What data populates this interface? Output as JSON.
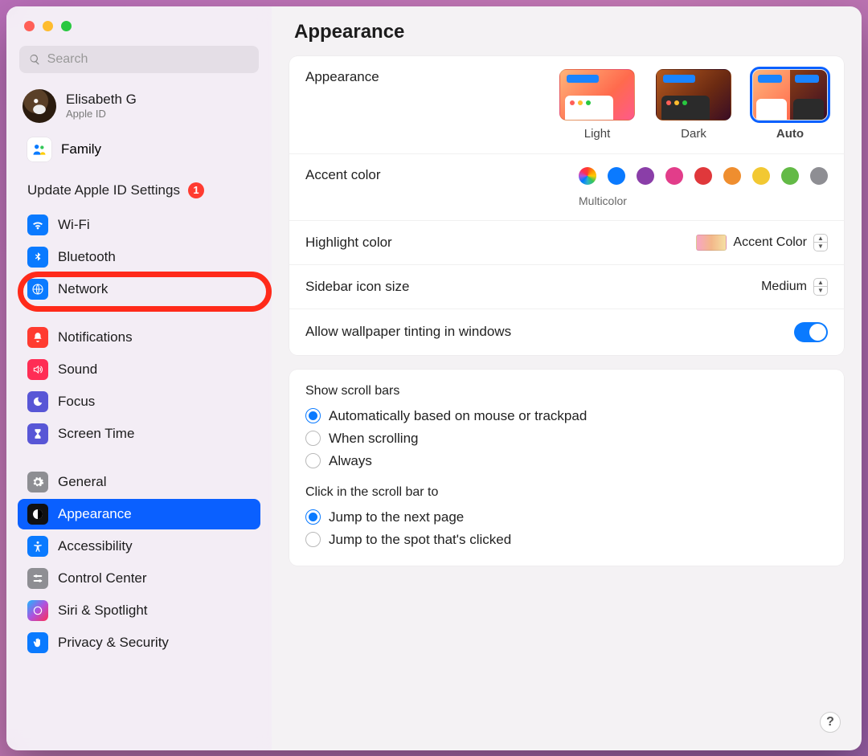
{
  "window": {
    "title": "Appearance"
  },
  "search": {
    "placeholder": "Search"
  },
  "user": {
    "name": "Elisabeth G",
    "subtitle": "Apple ID"
  },
  "family": {
    "label": "Family"
  },
  "update_notice": {
    "label": "Update Apple ID Settings",
    "badge": "1"
  },
  "sidebar": {
    "groups": [
      {
        "items": [
          {
            "key": "wifi",
            "label": "Wi-Fi"
          },
          {
            "key": "bluetooth",
            "label": "Bluetooth"
          },
          {
            "key": "network",
            "label": "Network"
          }
        ]
      },
      {
        "items": [
          {
            "key": "notifications",
            "label": "Notifications"
          },
          {
            "key": "sound",
            "label": "Sound"
          },
          {
            "key": "focus",
            "label": "Focus"
          },
          {
            "key": "screentime",
            "label": "Screen Time"
          }
        ]
      },
      {
        "items": [
          {
            "key": "general",
            "label": "General"
          },
          {
            "key": "appearance",
            "label": "Appearance",
            "selected": true
          },
          {
            "key": "accessibility",
            "label": "Accessibility"
          },
          {
            "key": "controlcenter",
            "label": "Control Center"
          },
          {
            "key": "siri",
            "label": "Siri & Spotlight"
          },
          {
            "key": "privacy",
            "label": "Privacy & Security"
          }
        ]
      }
    ]
  },
  "annotation": {
    "highlighted_item": "wifi"
  },
  "main": {
    "appearance": {
      "label": "Appearance",
      "options": {
        "light": "Light",
        "dark": "Dark",
        "auto": "Auto"
      },
      "selected": "auto"
    },
    "accent": {
      "label": "Accent color",
      "sublabel": "Multicolor",
      "colors": [
        "multicolor",
        "#0a7aff",
        "#8a3ea8",
        "#e23d8a",
        "#e0383b",
        "#ef8e2f",
        "#f2c832",
        "#63ba46",
        "#8e8e93"
      ],
      "selected": "multicolor"
    },
    "highlight": {
      "label": "Highlight color",
      "value": "Accent Color"
    },
    "sidebar_icon": {
      "label": "Sidebar icon size",
      "value": "Medium"
    },
    "tinting": {
      "label": "Allow wallpaper tinting in windows",
      "on": true
    },
    "scrollbars": {
      "label": "Show scroll bars",
      "options": [
        "Automatically based on mouse or trackpad",
        "When scrolling",
        "Always"
      ],
      "selected": 0
    },
    "scrollclick": {
      "label": "Click in the scroll bar to",
      "options": [
        "Jump to the next page",
        "Jump to the spot that's clicked"
      ],
      "selected": 0
    }
  },
  "help": "?"
}
